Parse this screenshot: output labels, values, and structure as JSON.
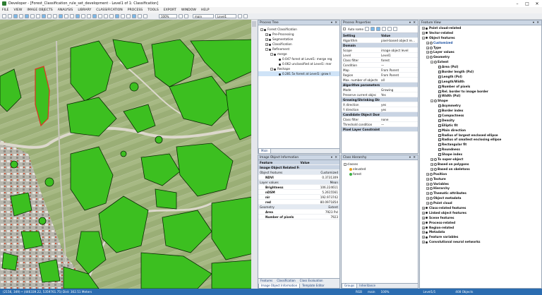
{
  "window": {
    "title": "Developer - [Forest_Classification_rule_set_development - Level1 of 1: Classification]",
    "controls": [
      "–",
      "□",
      "✕"
    ]
  },
  "menu": [
    "FILE",
    "VIEW",
    "IMAGE OBJECTS",
    "ANALYSIS",
    "LIBRARY",
    "CLASSIFICATION",
    "PROCESS",
    "TOOLS",
    "EXPORT",
    "WINDOW",
    "HELP"
  ],
  "toolbar": {
    "zoom": "100%",
    "map": "main",
    "level": "Level1"
  },
  "process_tree": {
    "title": "Process Tree",
    "tab": "Main",
    "items": [
      {
        "text": "Forest Classification",
        "depth": 0,
        "ex": "-"
      },
      {
        "text": "Pre-Processing",
        "depth": 1,
        "ex": "+"
      },
      {
        "text": "Segmentation",
        "depth": 1,
        "ex": "+"
      },
      {
        "text": "Classification",
        "depth": 1,
        "ex": "+"
      },
      {
        "text": "Refinement",
        "depth": 1,
        "ex": "-"
      },
      {
        "text": "merge",
        "depth": 2,
        "ex": "-"
      },
      {
        "text": "0.047  forest at  Level1: merge reg",
        "depth": 3,
        "ex": ""
      },
      {
        "text": "0.062  unclassified at  Level1: mer",
        "depth": 3,
        "ex": ""
      },
      {
        "text": "Reshape",
        "depth": 2,
        "ex": "-"
      },
      {
        "text": "0.281  5x forest at  Level1: grow t",
        "depth": 3,
        "ex": "",
        "hl": true
      }
    ]
  },
  "process_properties": {
    "title": "Process Properties",
    "auto_name": "Auto name",
    "columns": [
      "Setting",
      "Value"
    ],
    "rows": [
      {
        "s": "Algorithm",
        "v": "pixel-based object re…"
      },
      {
        "s": "Domain",
        "v": "",
        "sec": true
      },
      {
        "s": "Scope",
        "v": "image object level"
      },
      {
        "s": "Level",
        "v": "Level1"
      },
      {
        "s": "Class filter",
        "v": "forest"
      },
      {
        "s": "Condition",
        "v": "—"
      },
      {
        "s": "Map",
        "v": "From Parent"
      },
      {
        "s": "Region",
        "v": "From Parent"
      },
      {
        "s": "Max. number of objects",
        "v": "all"
      },
      {
        "s": "Algorithm parameters",
        "v": "",
        "sec": true
      },
      {
        "s": "Mode",
        "v": "Growing"
      },
      {
        "s": "Preserve current objec",
        "v": "Yes"
      },
      {
        "s": "Growing/Shrinking Directions",
        "v": "",
        "sec": true
      },
      {
        "s": "X direction",
        "v": "yes"
      },
      {
        "s": "Y direction",
        "v": "yes"
      },
      {
        "s": "Candidate Object Domain",
        "v": "",
        "sec": true
      },
      {
        "s": "Class filter",
        "v": "none"
      },
      {
        "s": "Threshold condition",
        "v": "—"
      },
      {
        "s": "Pixel Layer Constraint 1",
        "v": "",
        "sec": true
      }
    ]
  },
  "image_object_info": {
    "title": "Image Object Information",
    "columns": [
      "Feature",
      "Value"
    ],
    "rows": [
      {
        "f": "Image Object Related Features",
        "v": "",
        "sec": true
      },
      {
        "f": "Object features",
        "v": "Customized",
        "sub": true
      },
      {
        "f": "NDVI",
        "v": "0.3731309"
      },
      {
        "f": "Layer values",
        "v": "Mean",
        "sub": true
      },
      {
        "f": "Brightness",
        "v": "106.224611"
      },
      {
        "f": "nDSM",
        "v": "5.2615561"
      },
      {
        "f": "nir",
        "v": "192.973742"
      },
      {
        "f": "red",
        "v": "80.0971854"
      },
      {
        "f": "Geometry",
        "v": "Extent",
        "sub": true
      },
      {
        "f": "Area",
        "v": "7923 Pxl"
      },
      {
        "f": "Number of pixels",
        "v": "7923"
      }
    ],
    "tabs": [
      "Features",
      "Classification",
      "Class Evaluation",
      "Image Object Information",
      "Template Editor"
    ]
  },
  "class_hierarchy": {
    "title": "Class Hierarchy",
    "root": "classes",
    "classes": [
      {
        "name": "elevated",
        "color": "#e8a020"
      },
      {
        "name": "forest",
        "color": "#3cb043"
      }
    ],
    "tabs": [
      "Groups",
      "Inheritance"
    ]
  },
  "feature_view": {
    "title": "Feature View",
    "items": [
      {
        "t": "Point cloud-related",
        "d": 0,
        "e": "+"
      },
      {
        "t": "Vector-related",
        "d": 0,
        "e": "+"
      },
      {
        "t": "Object features",
        "d": 0,
        "e": "-"
      },
      {
        "t": "Customized",
        "d": 1,
        "e": "+",
        "blue": true
      },
      {
        "t": "Type",
        "d": 1,
        "e": "+"
      },
      {
        "t": "Layer values",
        "d": 1,
        "e": "+"
      },
      {
        "t": "Geometry",
        "d": 1,
        "e": "-"
      },
      {
        "t": "Extent",
        "d": 2,
        "e": "-"
      },
      {
        "t": "Area (Pxl)",
        "d": 3
      },
      {
        "t": "Border length (Pxl)",
        "d": 3
      },
      {
        "t": "Length (Pxl)",
        "d": 3
      },
      {
        "t": "Length/Width",
        "d": 3
      },
      {
        "t": "Number of pixels",
        "d": 3
      },
      {
        "t": "Rel. border to image border",
        "d": 3
      },
      {
        "t": "Width (Pxl)",
        "d": 3
      },
      {
        "t": "Shape",
        "d": 2,
        "e": "-"
      },
      {
        "t": "Asymmetry",
        "d": 3
      },
      {
        "t": "Border index",
        "d": 3
      },
      {
        "t": "Compactness",
        "d": 3
      },
      {
        "t": "Density",
        "d": 3
      },
      {
        "t": "Elliptic fit",
        "d": 3
      },
      {
        "t": "Main direction",
        "d": 3
      },
      {
        "t": "Radius of largest enclosed ellipse",
        "d": 3
      },
      {
        "t": "Radius of smallest enclosing ellipse",
        "d": 3
      },
      {
        "t": "Rectangular fit",
        "d": 3
      },
      {
        "t": "Roundness",
        "d": 3
      },
      {
        "t": "Shape index",
        "d": 3
      },
      {
        "t": "To super-object",
        "d": 2,
        "e": "+"
      },
      {
        "t": "Based on polygons",
        "d": 2,
        "e": "+"
      },
      {
        "t": "Based on skeletons",
        "d": 2,
        "e": "+"
      },
      {
        "t": "Position",
        "d": 1,
        "e": "+"
      },
      {
        "t": "Texture",
        "d": 1,
        "e": "+"
      },
      {
        "t": "Variables",
        "d": 1,
        "e": "+"
      },
      {
        "t": "Hierarchy",
        "d": 1,
        "e": "+"
      },
      {
        "t": "Thematic attributes",
        "d": 1,
        "e": "+"
      },
      {
        "t": "Object metadata",
        "d": 1,
        "e": "+"
      },
      {
        "t": "Point cloud",
        "d": 1,
        "e": "+"
      },
      {
        "t": "Class-related features",
        "d": 0,
        "e": "+"
      },
      {
        "t": "Linked object features",
        "d": 0,
        "e": "+"
      },
      {
        "t": "Scene features",
        "d": 0,
        "e": "+"
      },
      {
        "t": "Process-related",
        "d": 0,
        "e": "+"
      },
      {
        "t": "Region-related",
        "d": 0,
        "e": "+"
      },
      {
        "t": "Metadata",
        "d": 0,
        "e": "+"
      },
      {
        "t": "Feature variables",
        "d": 0,
        "e": "+"
      },
      {
        "t": "Convolutional neural networks",
        "d": 0,
        "e": "+"
      }
    ]
  },
  "status": {
    "coords": "(2156, 349)  •  (446339.22, 5359761.75)  Dist: 302.51 Meters",
    "mode": "RGB",
    "map": "main",
    "zoom": "100%",
    "level": "Level1/1",
    "objects": "408 Objects"
  },
  "colors": {
    "forest": "#3cbf20",
    "outline": "#0a2a05",
    "selected": "#e03020",
    "title_bar": "#cbd6e4",
    "status_bar": "#2b6cb0"
  }
}
